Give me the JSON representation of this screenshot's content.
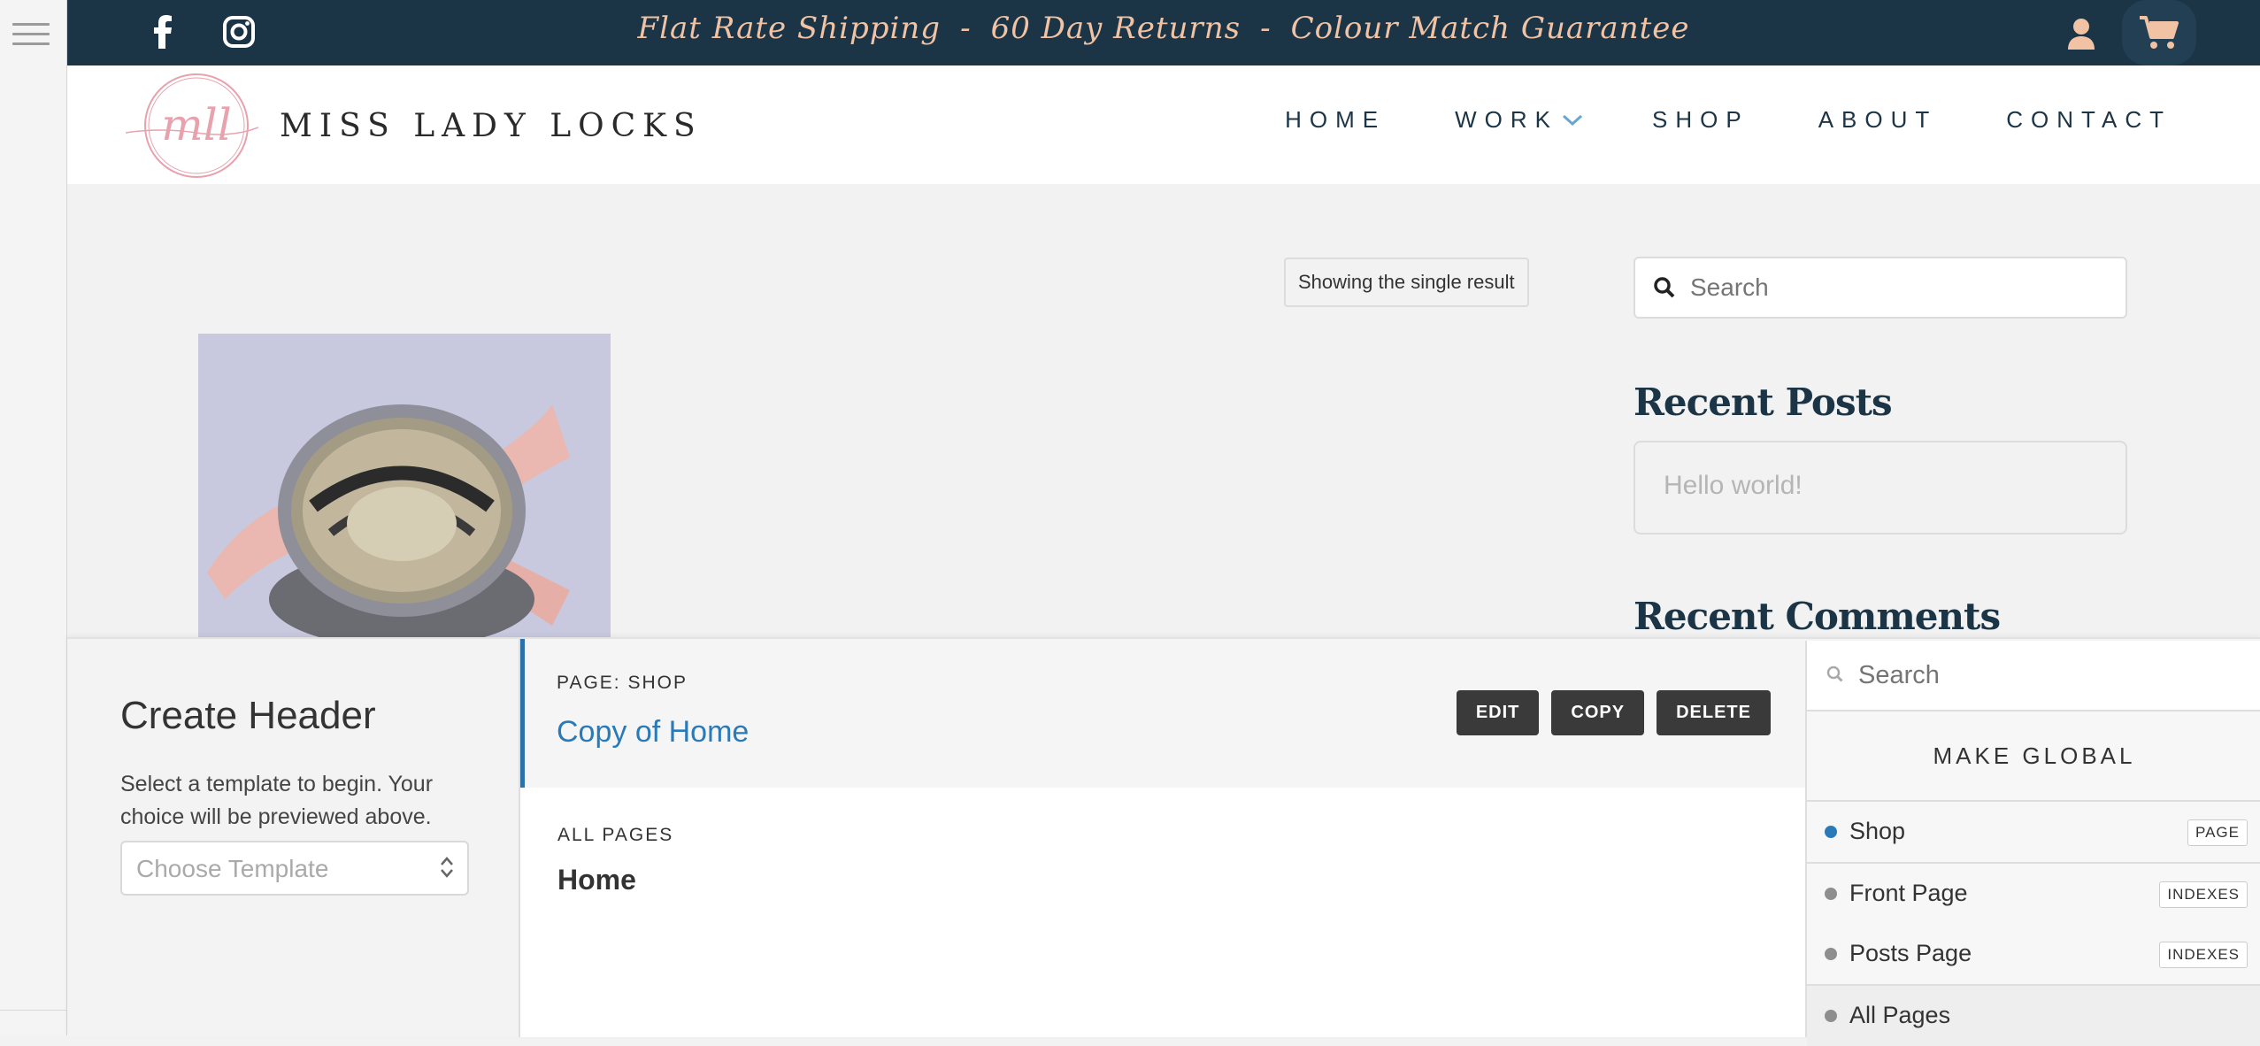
{
  "topbar": {
    "promo": [
      "Flat Rate Shipping",
      "60 Day Returns",
      "Colour Match Guarantee"
    ],
    "promo_sep": "-",
    "icons": [
      "facebook-icon",
      "instagram-icon",
      "user-icon",
      "cart-icon"
    ]
  },
  "header": {
    "logo_mark": "mll",
    "brand": "MISS LADY LOCKS",
    "nav": [
      "HOME",
      "WORK",
      "SHOP",
      "ABOUT",
      "CONTACT"
    ]
  },
  "main": {
    "result_count": "Showing the single result"
  },
  "sidebar": {
    "search_placeholder": "Search",
    "recent_posts_title": "Recent Posts",
    "recent_post": "Hello world!",
    "recent_comments_title": "Recent Comments"
  },
  "panel": {
    "create_title": "Create Header",
    "create_help": "Select a template to begin. Your choice will be previewed above.",
    "choose_placeholder": "Choose Template",
    "page_label": "PAGE: SHOP",
    "page_link": "Copy of Home",
    "buttons": {
      "edit": "EDIT",
      "copy": "COPY",
      "delete": "DELETE"
    },
    "all_pages_label": "ALL PAGES",
    "all_pages_item": "Home",
    "right_search_placeholder": "Search",
    "make_global": "MAKE GLOBAL",
    "locations": [
      {
        "label": "Shop",
        "tag": "PAGE",
        "active": true
      },
      {
        "label": "Front Page",
        "tag": "INDEXES",
        "active": false
      },
      {
        "label": "Posts Page",
        "tag": "INDEXES",
        "active": false
      },
      {
        "label": "All Pages",
        "tag": "",
        "active": false
      }
    ]
  },
  "colors": {
    "topbar_bg": "#1b3547",
    "promo": "#f1c3a4",
    "accent_blue": "#2a7ab8",
    "dark_button": "#3a3a3a"
  }
}
